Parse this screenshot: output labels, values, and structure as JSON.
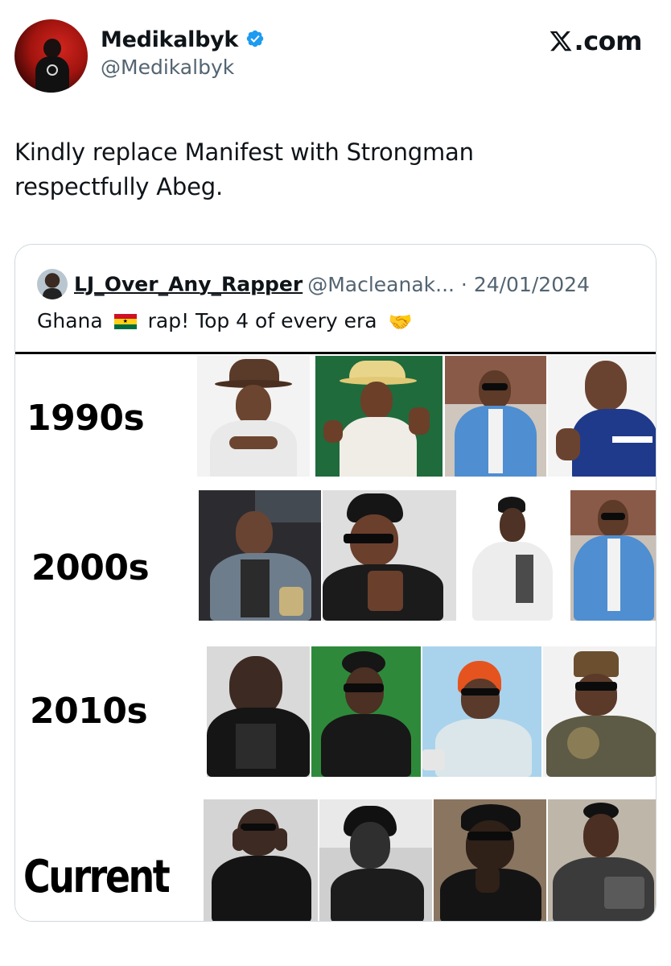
{
  "post": {
    "display_name": "Medikalbyk",
    "handle": "@Medikalbyk",
    "brand": ".com",
    "text_line1": "Kindly replace Manifest with Strongman",
    "text_line2": "respectfully Abeg."
  },
  "quoted_post": {
    "display_name": "LJ_Over_Any_Rapper",
    "meta": "@Macleanak... · 24/01/2024",
    "text_before_flag": "Ghana",
    "text_after_flag": "rap! Top 4 of every era",
    "flag_icon": "ghana-flag-icon",
    "emoji_icon": "handshake-icon"
  },
  "eras": [
    {
      "label": "1990s"
    },
    {
      "label": "2000s"
    },
    {
      "label": "2010s"
    },
    {
      "label": "Current"
    }
  ],
  "colors": {
    "verified_blue": "#1d9bf0",
    "secondary_text": "#536471",
    "border": "#cfd9de"
  }
}
